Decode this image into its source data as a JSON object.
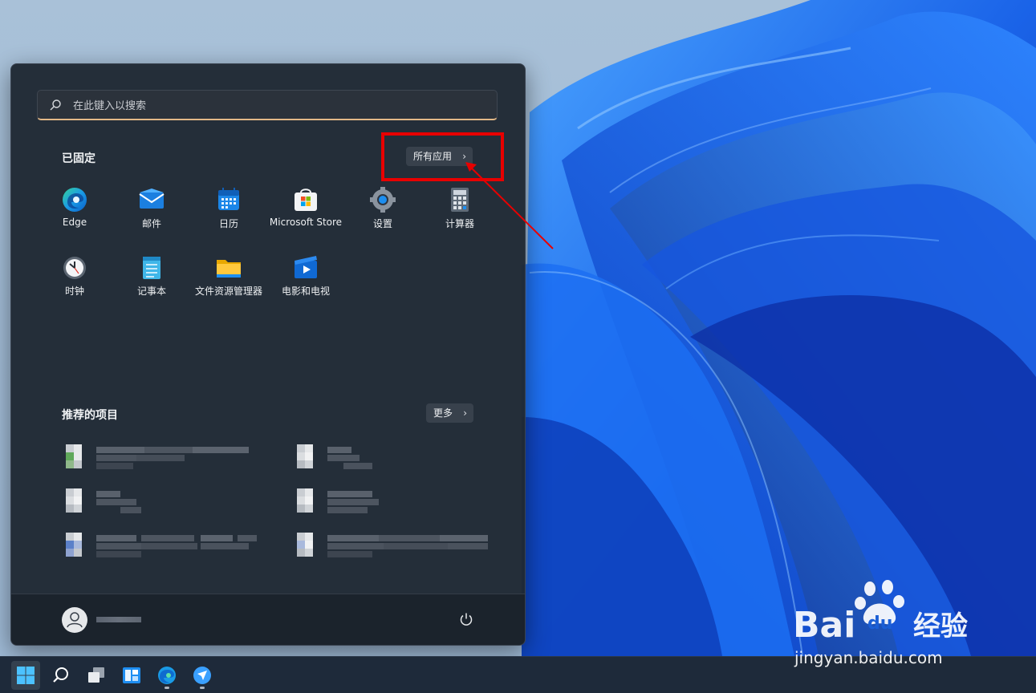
{
  "search": {
    "placeholder": "在此键入以搜索"
  },
  "pinned": {
    "title": "已固定",
    "all_apps_label": "所有应用",
    "apps": [
      {
        "label": "Edge",
        "icon": "edge-icon"
      },
      {
        "label": "邮件",
        "icon": "mail-icon"
      },
      {
        "label": "日历",
        "icon": "calendar-icon"
      },
      {
        "label": "Microsoft Store",
        "icon": "store-icon"
      },
      {
        "label": "设置",
        "icon": "settings-icon"
      },
      {
        "label": "计算器",
        "icon": "calculator-icon"
      },
      {
        "label": "时钟",
        "icon": "clock-icon"
      },
      {
        "label": "记事本",
        "icon": "notepad-icon"
      },
      {
        "label": "文件资源管理器",
        "icon": "folder-icon"
      },
      {
        "label": "电影和电视",
        "icon": "movies-icon"
      }
    ]
  },
  "recommended": {
    "title": "推荐的项目",
    "more_label": "更多"
  },
  "footer": {
    "power_icon": "power-icon"
  },
  "taskbar": {
    "items": [
      "windows-start-icon",
      "search-icon",
      "task-view-icon",
      "widgets-icon",
      "edge-icon",
      "app-icon"
    ]
  },
  "watermark": {
    "url": "jingyan.baidu.com"
  },
  "colors": {
    "annotation": "#e80000",
    "search_accent": "#e3b887",
    "menu_bg": "#202934"
  }
}
